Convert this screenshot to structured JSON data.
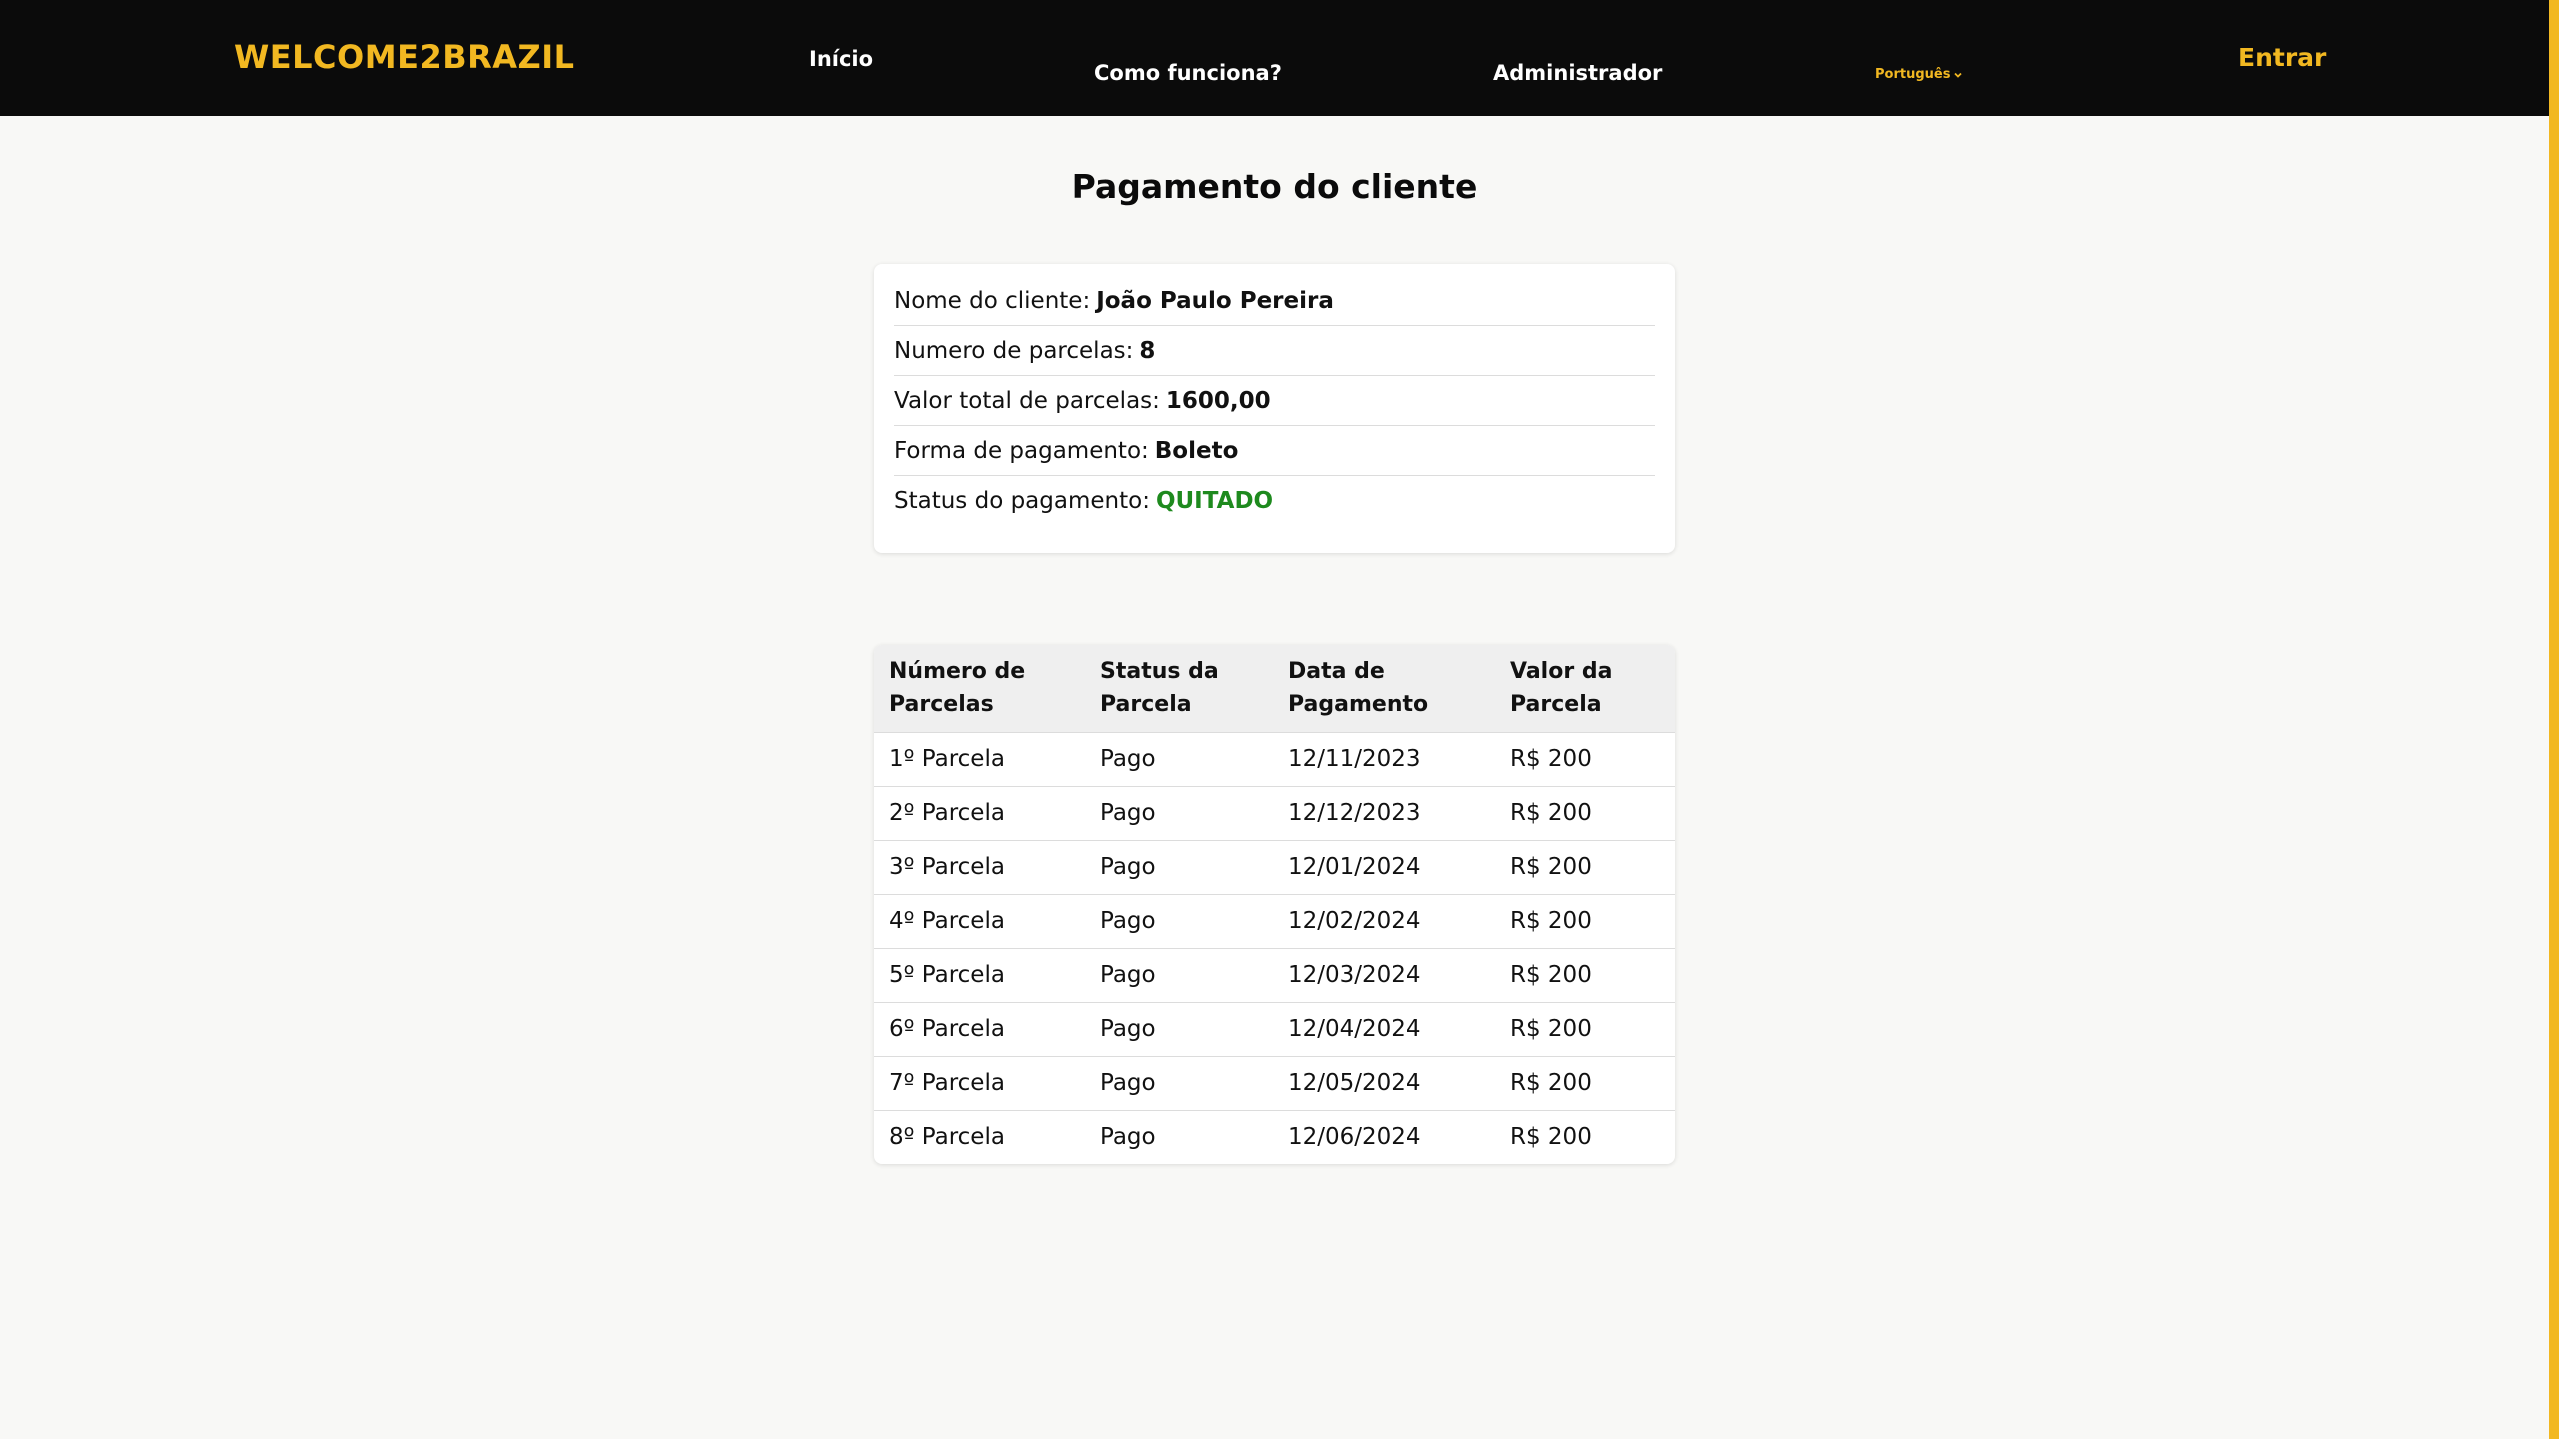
{
  "brand": "WELCOME2BRAZIL",
  "nav": {
    "home": "Início",
    "how_it_works": "Como funciona?",
    "admin": "Administrador",
    "language": "Português",
    "login": "Entrar"
  },
  "colors": {
    "accent": "#f2b821",
    "navbar_bg": "#0b0b0b",
    "paid_status": "#1e8a1e"
  },
  "title": "Pagamento do cliente",
  "summary": {
    "client_name": {
      "label": "Nome do cliente:",
      "value": "João Paulo Pereira"
    },
    "installments_count": {
      "label": "Numero de parcelas:",
      "value": "8"
    },
    "total_value": {
      "label": "Valor total de parcelas:",
      "value": "1600,00"
    },
    "payment_method": {
      "label": "Forma de pagamento:",
      "value": "Boleto"
    },
    "payment_status": {
      "label": "Status do pagamento:",
      "value": "QUITADO"
    }
  },
  "table": {
    "headers": [
      "Número de Parcelas",
      "Status da Parcela",
      "Data de Pagamento",
      "Valor da Parcela"
    ],
    "rows": [
      [
        "1º Parcela",
        "Pago",
        "12/11/2023",
        "R$ 200"
      ],
      [
        "2º Parcela",
        "Pago",
        "12/12/2023",
        "R$ 200"
      ],
      [
        "3º Parcela",
        "Pago",
        "12/01/2024",
        "R$ 200"
      ],
      [
        "4º Parcela",
        "Pago",
        "12/02/2024",
        "R$ 200"
      ],
      [
        "5º Parcela",
        "Pago",
        "12/03/2024",
        "R$ 200"
      ],
      [
        "6º Parcela",
        "Pago",
        "12/04/2024",
        "R$ 200"
      ],
      [
        "7º Parcela",
        "Pago",
        "12/05/2024",
        "R$ 200"
      ],
      [
        "8º Parcela",
        "Pago",
        "12/06/2024",
        "R$ 200"
      ]
    ]
  }
}
